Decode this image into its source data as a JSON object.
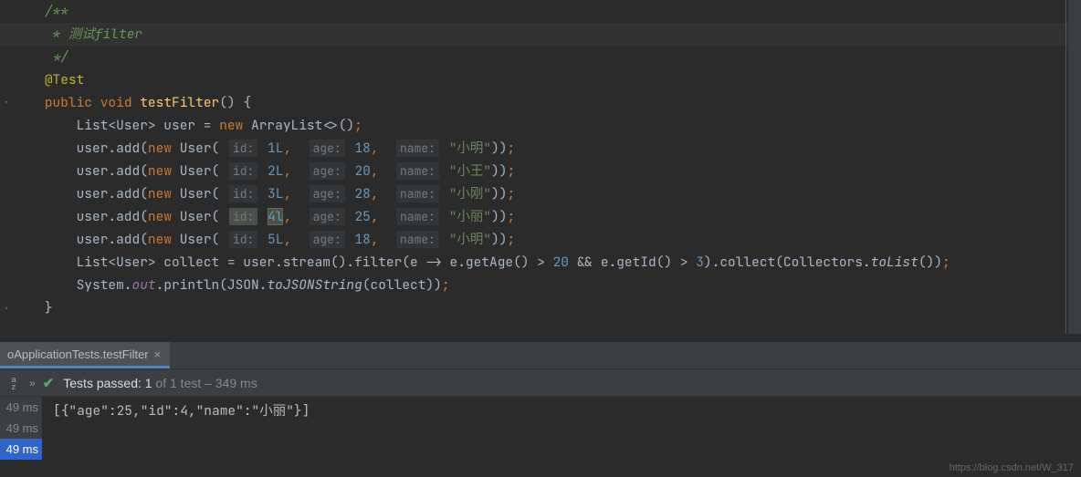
{
  "code": {
    "comment_open": "/**",
    "comment_body": " * 测试filter",
    "comment_close": " */",
    "annotation": "@Test",
    "sig_public": "public",
    "sig_void": "void",
    "sig_method": "testFilter",
    "sig_paren": "() {",
    "list_decl_pre": "List<User> user = ",
    "new_kw": "new",
    "arraylist_ctor": " ArrayList<>()",
    "semi": ";",
    "add_call_prefix": "user.add(",
    "user_ctor": " User(",
    "hint_id": "id:",
    "hint_age": "age:",
    "hint_name": "name:",
    "add_call_suffix": "))",
    "rows": [
      {
        "id": "1L",
        "age": "18",
        "name": "\"小明\""
      },
      {
        "id": "2L",
        "age": "20",
        "name": "\"小王\""
      },
      {
        "id": "3L",
        "age": "28",
        "name": "\"小刚\""
      },
      {
        "id": "4l",
        "age": "25",
        "name": "\"小丽\""
      },
      {
        "id": "5L",
        "age": "18",
        "name": "\"小明\""
      }
    ],
    "stream_line_pre": "List<User> collect = user.stream().filter(e -> e.getAge() > ",
    "stream_gt1_val": "20",
    "stream_mid": " && e.getId() > ",
    "stream_gt2_val": "3",
    "stream_after": ").collect(Collectors.",
    "stream_tolist": "toList",
    "stream_end": "())",
    "println_pre": "System.",
    "println_out": "out",
    "println_mid": ".println(JSON.",
    "println_tojson": "toJSONString",
    "println_after": "(collect))",
    "brace_close": "}"
  },
  "tab": {
    "label": "oApplicationTests.testFilter"
  },
  "results": {
    "strong": "Tests passed: 1",
    "dim": " of 1 test – 349 ms"
  },
  "times": {
    "t1": "49 ms",
    "t2": "49 ms",
    "t3": "49 ms"
  },
  "console": {
    "output": "[{\"age\":25,\"id\":4,\"name\":\"小丽\"}]"
  },
  "watermark": "https://blog.csdn.net/W_317"
}
